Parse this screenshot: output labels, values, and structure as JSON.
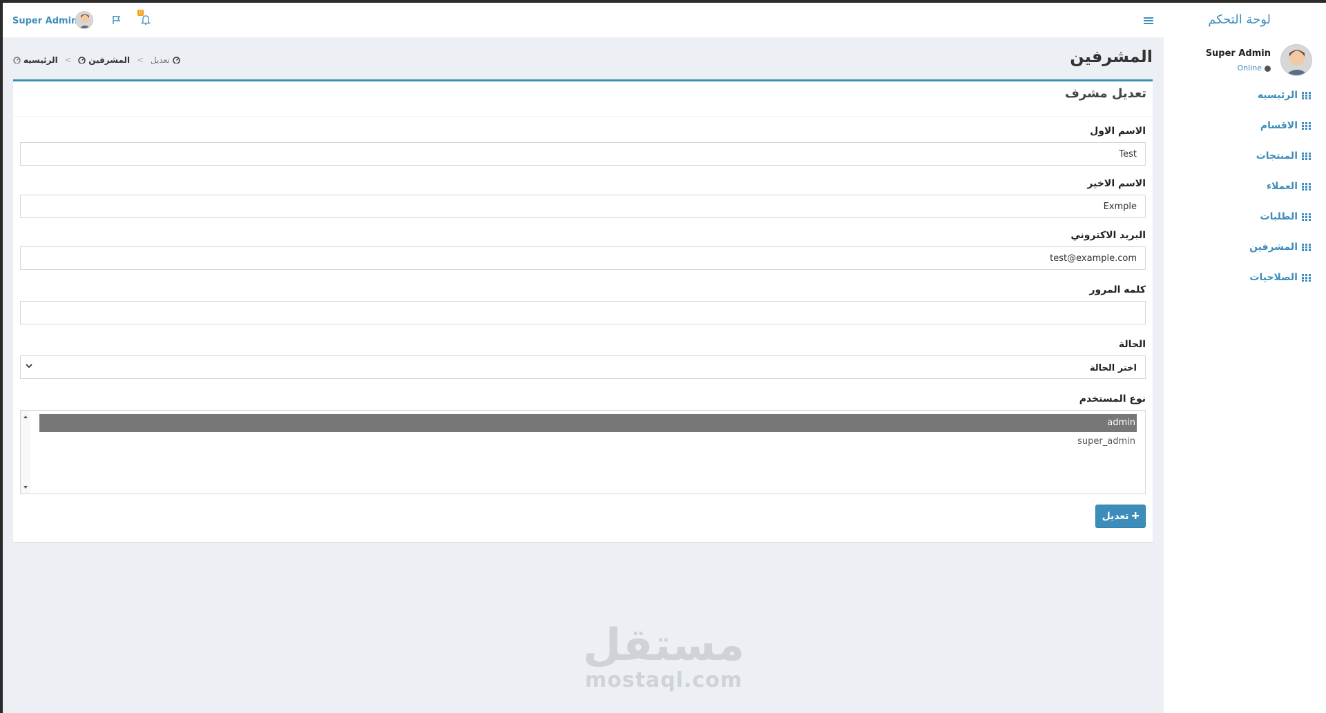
{
  "colors": {
    "accent": "#3c8dbc",
    "badge": "#f39c12",
    "content_bg": "#ecf0f5"
  },
  "topbar": {
    "user_name": "Super Admin",
    "notifications_count": "0",
    "menu_icon": "hamburger-icon",
    "flag_icon": "flag-icon",
    "bell_icon": "bell-icon"
  },
  "sidebar": {
    "brand": "لوحة التحكم",
    "user": {
      "name": "Super Admin",
      "status": "Online"
    },
    "items": [
      {
        "label": "الرئيسيه",
        "icon": "grid-icon"
      },
      {
        "label": "الاقسام",
        "icon": "grid-icon"
      },
      {
        "label": "المنتجات",
        "icon": "grid-icon"
      },
      {
        "label": "العملاء",
        "icon": "grid-icon"
      },
      {
        "label": "الطلبات",
        "icon": "grid-icon"
      },
      {
        "label": "المشرفين",
        "icon": "grid-icon"
      },
      {
        "label": "الصلاحيات",
        "icon": "grid-icon"
      }
    ]
  },
  "page": {
    "title": "المشرفين",
    "breadcrumb": [
      "الرئيسيه",
      "المشرفين",
      "تعديل"
    ],
    "box_title": "تعديل مشرف"
  },
  "form": {
    "first_name": {
      "label": "الاسم الاول",
      "value": "Test"
    },
    "last_name": {
      "label": "الاسم الاخير",
      "value": "Exmple"
    },
    "email": {
      "label": "البريد الاكتروني",
      "value": "test@example.com"
    },
    "password": {
      "label": "كلمه المرور",
      "value": ""
    },
    "status": {
      "label": "الحالة",
      "selected": "اختر الحالة"
    },
    "user_type": {
      "label": "نوع المستخدم",
      "options": [
        "admin",
        "super_admin"
      ],
      "selected": "admin"
    },
    "submit_label": "تعديل"
  },
  "watermark": {
    "arabic": "مستقل",
    "latin": "mostaql.com"
  }
}
